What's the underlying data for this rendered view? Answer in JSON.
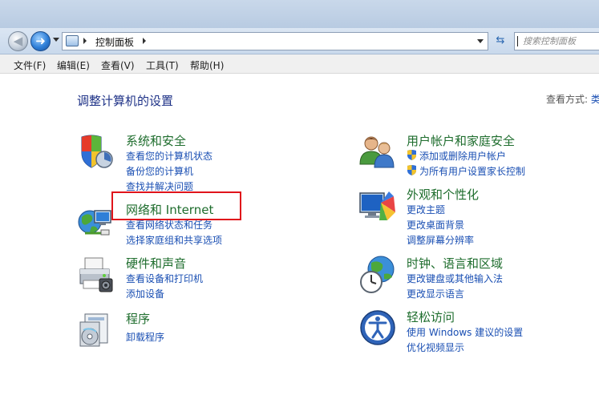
{
  "address": {
    "location": "控制面板",
    "search_placeholder": "搜索控制面板"
  },
  "menu": [
    "文件(F)",
    "编辑(E)",
    "查看(V)",
    "工具(T)",
    "帮助(H)"
  ],
  "page": {
    "title": "调整计算机的设置",
    "view_by": "查看方式:",
    "view_by_value": "类"
  },
  "categories": [
    {
      "title": "系统和安全",
      "icon": "shield-icon",
      "links": [
        "查看您的计算机状态",
        "备份您的计算机",
        "查找并解决问题"
      ]
    },
    {
      "title": "网络和 Internet",
      "icon": "network-icon",
      "links": [
        "查看网络状态和任务",
        "选择家庭组和共享选项"
      ]
    },
    {
      "title": "硬件和声音",
      "icon": "printer-icon",
      "links": [
        "查看设备和打印机",
        "添加设备"
      ]
    },
    {
      "title": "程序",
      "icon": "programs-icon",
      "links": [
        "卸载程序"
      ]
    },
    {
      "title": "用户帐户和家庭安全",
      "icon": "users-icon",
      "links": [
        "添加或删除用户帐户",
        "为所有用户设置家长控制"
      ]
    },
    {
      "title": "外观和个性化",
      "icon": "appearance-icon",
      "links": [
        "更改主题",
        "更改桌面背景",
        "调整屏幕分辨率"
      ]
    },
    {
      "title": "时钟、语言和区域",
      "icon": "clock-globe-icon",
      "links": [
        "更改键盘或其他输入法",
        "更改显示语言"
      ]
    },
    {
      "title": "轻松访问",
      "icon": "ease-of-access-icon",
      "links": [
        "使用 Windows 建议的设置",
        "优化视频显示"
      ]
    }
  ],
  "colors": {
    "category_title": "#1e6d2d",
    "link": "#1a4fb3",
    "highlight_border": "#e0141b",
    "page_title": "#1e3287"
  }
}
